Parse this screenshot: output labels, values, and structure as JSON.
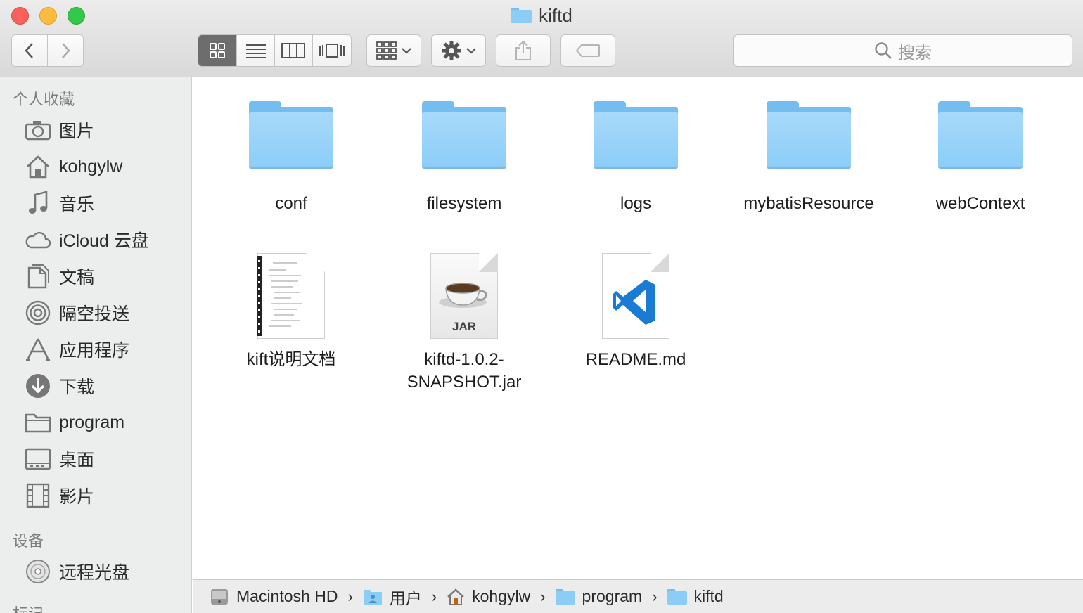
{
  "window": {
    "title": "kiftd"
  },
  "toolbar": {
    "search_placeholder": "搜索"
  },
  "sidebar": {
    "favorites_header": "个人收藏",
    "devices_header": "设备",
    "tags_header": "标记",
    "favorites": [
      {
        "label": "图片",
        "icon": "camera-icon"
      },
      {
        "label": "kohgylw",
        "icon": "home-icon"
      },
      {
        "label": "音乐",
        "icon": "music-note-icon"
      },
      {
        "label": "iCloud 云盘",
        "icon": "cloud-icon"
      },
      {
        "label": "文稿",
        "icon": "documents-icon"
      },
      {
        "label": "隔空投送",
        "icon": "airdrop-icon"
      },
      {
        "label": "应用程序",
        "icon": "applications-icon"
      },
      {
        "label": "下载",
        "icon": "download-icon"
      },
      {
        "label": "program",
        "icon": "folder-icon"
      },
      {
        "label": "桌面",
        "icon": "desktop-icon"
      },
      {
        "label": "影片",
        "icon": "film-icon"
      }
    ],
    "devices": [
      {
        "label": "远程光盘",
        "icon": "disc-icon"
      }
    ]
  },
  "files": [
    {
      "name": "conf",
      "kind": "folder"
    },
    {
      "name": "filesystem",
      "kind": "folder"
    },
    {
      "name": "logs",
      "kind": "folder"
    },
    {
      "name": "mybatisResource",
      "kind": "folder"
    },
    {
      "name": "webContext",
      "kind": "folder"
    },
    {
      "name": "kift说明文档",
      "kind": "document"
    },
    {
      "name_line1": "kiftd-1.0.2-",
      "name_line2": "SNAPSHOT.jar",
      "kind": "jar",
      "badge": "JAR"
    },
    {
      "name": "README.md",
      "kind": "markdown"
    }
  ],
  "pathbar": [
    {
      "label": "Macintosh HD",
      "icon": "hard-drive-icon"
    },
    {
      "label": "用户",
      "icon": "users-folder-icon"
    },
    {
      "label": "kohgylw",
      "icon": "home-icon"
    },
    {
      "label": "program",
      "icon": "folder-icon"
    },
    {
      "label": "kiftd",
      "icon": "folder-icon"
    }
  ],
  "colors": {
    "folder_blue": "#8ccdf8",
    "close": "#fc605c",
    "minimize": "#fdbc40",
    "maximize": "#34c84a",
    "vscode_blue": "#1a7bd4"
  }
}
